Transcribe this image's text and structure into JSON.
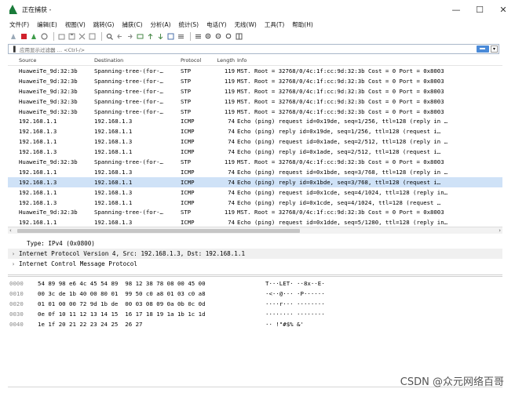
{
  "window": {
    "title": "正在捕获 -",
    "minimize": "—",
    "maximize": "☐",
    "close": "✕"
  },
  "menu": {
    "items": [
      {
        "label": "文件(F)"
      },
      {
        "label": "编辑(E)"
      },
      {
        "label": "视图(V)"
      },
      {
        "label": "跳转(G)"
      },
      {
        "label": "捕获(C)"
      },
      {
        "label": "分析(A)"
      },
      {
        "label": "统计(S)"
      },
      {
        "label": "电话(Y)"
      },
      {
        "label": "无线(W)"
      },
      {
        "label": "工具(T)"
      },
      {
        "label": "帮助(H)"
      }
    ]
  },
  "filter": {
    "placeholder": "应用显示过滤器 … <Ctrl-/>"
  },
  "packet_list": {
    "headers": {
      "source": "Source",
      "destination": "Destination",
      "protocol": "Protocol",
      "length": "Length",
      "info": "Info"
    },
    "rows": [
      {
        "source": "HuaweiTe_9d:32:3b",
        "destination": "Spanning-tree-(for-…",
        "protocol": "STP",
        "length": "119",
        "info": "MST. Root = 32768/0/4c:1f:cc:9d:32:3b  Cost = 0  Port = 0x8003",
        "selected": false
      },
      {
        "source": "HuaweiTe_9d:32:3b",
        "destination": "Spanning-tree-(for-…",
        "protocol": "STP",
        "length": "119",
        "info": "MST. Root = 32768/0/4c:1f:cc:9d:32:3b  Cost = 0  Port = 0x8003",
        "selected": false
      },
      {
        "source": "HuaweiTe_9d:32:3b",
        "destination": "Spanning-tree-(for-…",
        "protocol": "STP",
        "length": "119",
        "info": "MST. Root = 32768/0/4c:1f:cc:9d:32:3b  Cost = 0  Port = 0x8003",
        "selected": false
      },
      {
        "source": "HuaweiTe_9d:32:3b",
        "destination": "Spanning-tree-(for-…",
        "protocol": "STP",
        "length": "119",
        "info": "MST. Root = 32768/0/4c:1f:cc:9d:32:3b  Cost = 0  Port = 0x8003",
        "selected": false
      },
      {
        "source": "HuaweiTe_9d:32:3b",
        "destination": "Spanning-tree-(for-…",
        "protocol": "STP",
        "length": "119",
        "info": "MST. Root = 32768/0/4c:1f:cc:9d:32:3b  Cost = 0  Port = 0x8003",
        "selected": false
      },
      {
        "source": "192.168.1.1",
        "destination": "192.168.1.3",
        "protocol": "ICMP",
        "length": "74",
        "info": "Echo (ping) request  id=0x19de, seq=1/256, ttl=128 (reply in …",
        "selected": false
      },
      {
        "source": "192.168.1.3",
        "destination": "192.168.1.1",
        "protocol": "ICMP",
        "length": "74",
        "info": "Echo (ping) reply    id=0x19de, seq=1/256, ttl=128 (request i…",
        "selected": false
      },
      {
        "source": "192.168.1.1",
        "destination": "192.168.1.3",
        "protocol": "ICMP",
        "length": "74",
        "info": "Echo (ping) request  id=0x1ade, seq=2/512, ttl=128 (reply in …",
        "selected": false
      },
      {
        "source": "192.168.1.3",
        "destination": "192.168.1.1",
        "protocol": "ICMP",
        "length": "74",
        "info": "Echo (ping) reply    id=0x1ade, seq=2/512, ttl=128 (request i…",
        "selected": false
      },
      {
        "source": "HuaweiTe_9d:32:3b",
        "destination": "Spanning-tree-(for-…",
        "protocol": "STP",
        "length": "119",
        "info": "MST. Root = 32768/0/4c:1f:cc:9d:32:3b  Cost = 0  Port = 0x8003",
        "selected": false
      },
      {
        "source": "192.168.1.1",
        "destination": "192.168.1.3",
        "protocol": "ICMP",
        "length": "74",
        "info": "Echo (ping) request  id=0x1bde, seq=3/768, ttl=128 (reply in …",
        "selected": false
      },
      {
        "source": "192.168.1.3",
        "destination": "192.168.1.1",
        "protocol": "ICMP",
        "length": "74",
        "info": "Echo (ping) reply    id=0x1bde, seq=3/768, ttl=128 (request i…",
        "selected": true
      },
      {
        "source": "192.168.1.1",
        "destination": "192.168.1.3",
        "protocol": "ICMP",
        "length": "74",
        "info": "Echo (ping) request  id=0x1cde, seq=4/1024, ttl=128 (reply in…",
        "selected": false
      },
      {
        "source": "192.168.1.3",
        "destination": "192.168.1.1",
        "protocol": "ICMP",
        "length": "74",
        "info": "Echo (ping) reply    id=0x1cde, seq=4/1024, ttl=128 (request …",
        "selected": false
      },
      {
        "source": "HuaweiTe_9d:32:3b",
        "destination": "Spanning-tree-(for-…",
        "protocol": "STP",
        "length": "119",
        "info": "MST. Root = 32768/0/4c:1f:cc:9d:32:3b  Cost = 0  Port = 0x8003",
        "selected": false
      },
      {
        "source": "192.168.1.1",
        "destination": "192.168.1.3",
        "protocol": "ICMP",
        "length": "74",
        "info": "Echo (ping) request  id=0x1dde, seq=5/1280, ttl=128 (reply in…",
        "selected": false
      }
    ]
  },
  "details": {
    "rows": [
      {
        "text": "Type: IPv4 (0x0800)",
        "arrow": "",
        "indent": true
      },
      {
        "text": "Internet Protocol Version 4, Src: 192.168.1.3, Dst: 192.168.1.1",
        "arrow": "›",
        "indent": false
      },
      {
        "text": "Internet Control Message Protocol",
        "arrow": "›",
        "indent": false
      }
    ]
  },
  "bytes": {
    "rows": [
      {
        "offset": "0000",
        "hex": "54 89 98 e6 4c 45 54 89  98 12 38 78 08 00 45 00",
        "ascii": "T···LET· ··8x··E·"
      },
      {
        "offset": "0010",
        "hex": "00 3c de 1b 40 00 80 01  99 50 c0 a8 01 03 c0 a8",
        "ascii": "·<··@··· ·P······"
      },
      {
        "offset": "0020",
        "hex": "01 01 00 00 72 9d 1b de  00 03 08 09 0a 0b 0c 0d",
        "ascii": "····r··· ········"
      },
      {
        "offset": "0030",
        "hex": "0e 0f 10 11 12 13 14 15  16 17 18 19 1a 1b 1c 1d",
        "ascii": "········ ········"
      },
      {
        "offset": "0040",
        "hex": "1e 1f 20 21 22 23 24 25  26 27",
        "ascii": "·· !\"#$% &'"
      }
    ]
  },
  "watermark": "CSDN @众元网络百哥"
}
